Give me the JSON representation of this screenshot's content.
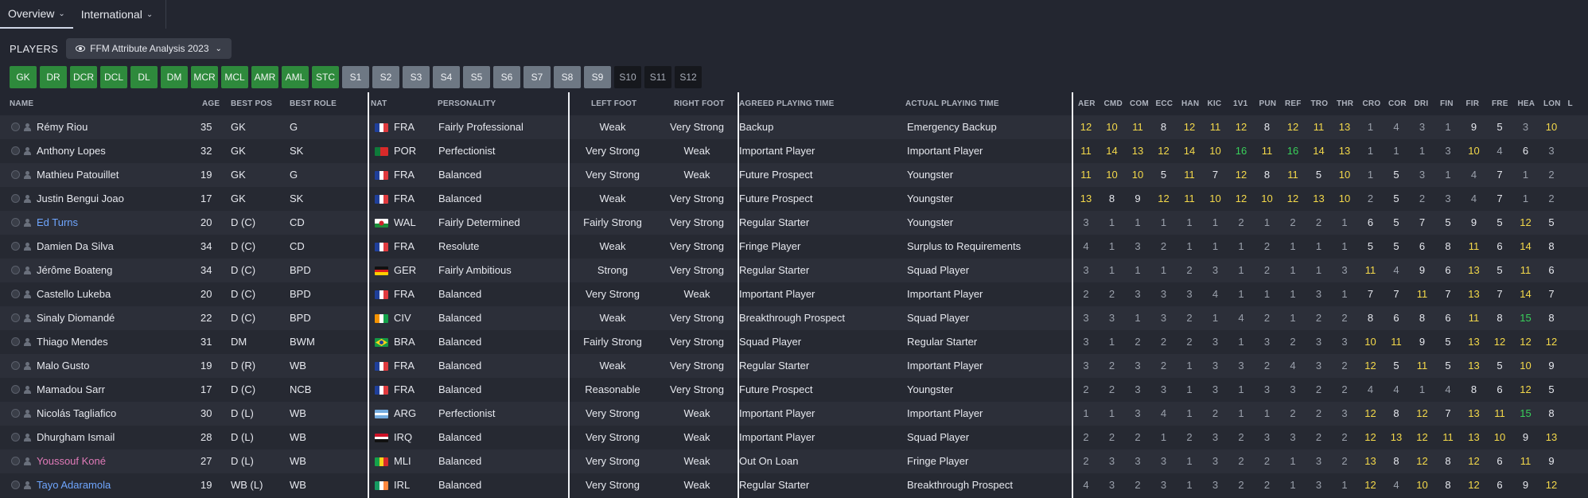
{
  "top_tabs": [
    {
      "label": "Overview",
      "active": true
    },
    {
      "label": "International",
      "active": false
    }
  ],
  "players_label": "PLAYERS",
  "view_selector": "FFM Attribute Analysis 2023",
  "position_filters": [
    {
      "label": "GK",
      "style": "green"
    },
    {
      "label": "DR",
      "style": "green"
    },
    {
      "label": "DCR",
      "style": "green"
    },
    {
      "label": "DCL",
      "style": "green"
    },
    {
      "label": "DL",
      "style": "green"
    },
    {
      "label": "DM",
      "style": "green"
    },
    {
      "label": "MCR",
      "style": "green"
    },
    {
      "label": "MCL",
      "style": "green"
    },
    {
      "label": "AMR",
      "style": "green"
    },
    {
      "label": "AML",
      "style": "green"
    },
    {
      "label": "STC",
      "style": "green"
    },
    {
      "label": "S1",
      "style": "grey"
    },
    {
      "label": "S2",
      "style": "grey"
    },
    {
      "label": "S3",
      "style": "grey"
    },
    {
      "label": "S4",
      "style": "grey"
    },
    {
      "label": "S5",
      "style": "grey"
    },
    {
      "label": "S6",
      "style": "grey"
    },
    {
      "label": "S7",
      "style": "grey"
    },
    {
      "label": "S8",
      "style": "grey"
    },
    {
      "label": "S9",
      "style": "grey"
    },
    {
      "label": "S10",
      "style": "dark"
    },
    {
      "label": "S11",
      "style": "dark"
    },
    {
      "label": "S12",
      "style": "dark"
    }
  ],
  "headers": {
    "name": "NAME",
    "age": "AGE",
    "best_pos": "BEST POS",
    "best_role": "BEST ROLE",
    "nat": "NAT",
    "personality": "PERSONALITY",
    "left_foot": "LEFT FOOT",
    "right_foot": "RIGHT FOOT",
    "agreed": "AGREED PLAYING TIME",
    "actual": "ACTUAL PLAYING TIME"
  },
  "attr_headers": [
    "AER",
    "CMD",
    "COM",
    "ECC",
    "HAN",
    "KIC",
    "1V1",
    "PUN",
    "REF",
    "TRO",
    "THR",
    "CRO",
    "COR",
    "DRI",
    "FIN",
    "FIR",
    "FRE",
    "HEA",
    "LON",
    "L"
  ],
  "attr_colors": {
    "low": "#9aa0ab",
    "mid": "#e6e8ee",
    "high": "#f4d94a",
    "top": "#39d05a"
  },
  "players": [
    {
      "name": "Rémy Riou",
      "color": "default",
      "age": "35",
      "pos": "GK",
      "role": "G",
      "flag": "fra",
      "nat": "FRA",
      "personality": "Fairly Professional",
      "lf": "Weak",
      "rf": "Very Strong",
      "agreed": "Backup",
      "actual": "Emergency Backup",
      "attrs": [
        12,
        10,
        11,
        8,
        12,
        11,
        12,
        8,
        12,
        11,
        13,
        1,
        4,
        3,
        1,
        9,
        5,
        3,
        10
      ]
    },
    {
      "name": "Anthony Lopes",
      "color": "default",
      "age": "32",
      "pos": "GK",
      "role": "SK",
      "flag": "por",
      "nat": "POR",
      "personality": "Perfectionist",
      "lf": "Very Strong",
      "rf": "Weak",
      "agreed": "Important Player",
      "actual": "Important Player",
      "attrs": [
        11,
        14,
        13,
        12,
        14,
        10,
        16,
        11,
        16,
        14,
        13,
        1,
        1,
        1,
        3,
        10,
        4,
        6,
        3
      ]
    },
    {
      "name": "Mathieu Patouillet",
      "color": "default",
      "age": "19",
      "pos": "GK",
      "role": "G",
      "flag": "fra",
      "nat": "FRA",
      "personality": "Balanced",
      "lf": "Very Strong",
      "rf": "Weak",
      "agreed": "Future Prospect",
      "actual": "Youngster",
      "attrs": [
        11,
        10,
        10,
        5,
        11,
        7,
        12,
        8,
        11,
        5,
        10,
        1,
        5,
        3,
        1,
        4,
        7,
        1,
        2
      ]
    },
    {
      "name": "Justin Bengui Joao",
      "color": "default",
      "age": "17",
      "pos": "GK",
      "role": "SK",
      "flag": "fra",
      "nat": "FRA",
      "personality": "Balanced",
      "lf": "Weak",
      "rf": "Very Strong",
      "agreed": "Future Prospect",
      "actual": "Youngster",
      "attrs": [
        13,
        8,
        9,
        12,
        11,
        10,
        12,
        10,
        12,
        13,
        10,
        2,
        5,
        2,
        3,
        4,
        7,
        1,
        2
      ]
    },
    {
      "name": "Ed Turns",
      "color": "blue",
      "age": "20",
      "pos": "D (C)",
      "role": "CD",
      "flag": "wal",
      "nat": "WAL",
      "personality": "Fairly Determined",
      "lf": "Fairly Strong",
      "rf": "Very Strong",
      "agreed": "Regular Starter",
      "actual": "Youngster",
      "attrs": [
        3,
        1,
        1,
        1,
        1,
        1,
        2,
        1,
        2,
        2,
        1,
        6,
        5,
        7,
        5,
        9,
        5,
        12,
        5
      ]
    },
    {
      "name": "Damien Da Silva",
      "color": "default",
      "age": "34",
      "pos": "D (C)",
      "role": "CD",
      "flag": "fra",
      "nat": "FRA",
      "personality": "Resolute",
      "lf": "Weak",
      "rf": "Very Strong",
      "agreed": "Fringe Player",
      "actual": "Surplus to Requirements",
      "attrs": [
        4,
        1,
        3,
        2,
        1,
        1,
        1,
        2,
        1,
        1,
        1,
        5,
        5,
        6,
        8,
        11,
        6,
        14,
        8
      ]
    },
    {
      "name": "Jérôme Boateng",
      "color": "default",
      "age": "34",
      "pos": "D (C)",
      "role": "BPD",
      "flag": "ger",
      "nat": "GER",
      "personality": "Fairly Ambitious",
      "lf": "Strong",
      "rf": "Very Strong",
      "agreed": "Regular Starter",
      "actual": "Squad Player",
      "attrs": [
        3,
        1,
        1,
        1,
        2,
        3,
        1,
        2,
        1,
        1,
        3,
        11,
        4,
        9,
        6,
        13,
        5,
        11,
        6
      ]
    },
    {
      "name": "Castello Lukeba",
      "color": "default",
      "age": "20",
      "pos": "D (C)",
      "role": "BPD",
      "flag": "fra",
      "nat": "FRA",
      "personality": "Balanced",
      "lf": "Very Strong",
      "rf": "Weak",
      "agreed": "Important Player",
      "actual": "Important Player",
      "attrs": [
        2,
        2,
        3,
        3,
        3,
        4,
        1,
        1,
        1,
        3,
        1,
        7,
        7,
        11,
        7,
        13,
        7,
        14,
        7
      ]
    },
    {
      "name": "Sinaly Diomandé",
      "color": "default",
      "age": "22",
      "pos": "D (C)",
      "role": "BPD",
      "flag": "civ",
      "nat": "CIV",
      "personality": "Balanced",
      "lf": "Weak",
      "rf": "Very Strong",
      "agreed": "Breakthrough Prospect",
      "actual": "Squad Player",
      "attrs": [
        3,
        3,
        1,
        3,
        2,
        1,
        4,
        2,
        1,
        2,
        2,
        8,
        6,
        8,
        6,
        11,
        8,
        15,
        8
      ]
    },
    {
      "name": "Thiago Mendes",
      "color": "default",
      "age": "31",
      "pos": "DM",
      "role": "BWM",
      "flag": "bra",
      "nat": "BRA",
      "personality": "Balanced",
      "lf": "Fairly Strong",
      "rf": "Very Strong",
      "agreed": "Squad Player",
      "actual": "Regular Starter",
      "attrs": [
        3,
        1,
        2,
        2,
        2,
        3,
        1,
        3,
        2,
        3,
        3,
        10,
        11,
        9,
        5,
        13,
        12,
        12,
        12
      ]
    },
    {
      "name": "Malo Gusto",
      "color": "default",
      "age": "19",
      "pos": "D (R)",
      "role": "WB",
      "flag": "fra",
      "nat": "FRA",
      "personality": "Balanced",
      "lf": "Weak",
      "rf": "Very Strong",
      "agreed": "Regular Starter",
      "actual": "Important Player",
      "attrs": [
        3,
        2,
        3,
        2,
        1,
        3,
        3,
        2,
        4,
        3,
        2,
        12,
        5,
        11,
        5,
        13,
        5,
        10,
        9
      ]
    },
    {
      "name": "Mamadou Sarr",
      "color": "default",
      "age": "17",
      "pos": "D (C)",
      "role": "NCB",
      "flag": "fra",
      "nat": "FRA",
      "personality": "Balanced",
      "lf": "Reasonable",
      "rf": "Very Strong",
      "agreed": "Future Prospect",
      "actual": "Youngster",
      "attrs": [
        2,
        2,
        3,
        3,
        1,
        3,
        1,
        3,
        3,
        2,
        2,
        4,
        4,
        1,
        4,
        8,
        6,
        12,
        5
      ]
    },
    {
      "name": "Nicolás Tagliafico",
      "color": "default",
      "age": "30",
      "pos": "D (L)",
      "role": "WB",
      "flag": "arg",
      "nat": "ARG",
      "personality": "Perfectionist",
      "lf": "Very Strong",
      "rf": "Weak",
      "agreed": "Important Player",
      "actual": "Important Player",
      "attrs": [
        1,
        1,
        3,
        4,
        1,
        2,
        1,
        1,
        2,
        2,
        3,
        12,
        8,
        12,
        7,
        13,
        11,
        15,
        8
      ]
    },
    {
      "name": "Dhurgham Ismail",
      "color": "default",
      "age": "28",
      "pos": "D (L)",
      "role": "WB",
      "flag": "irq",
      "nat": "IRQ",
      "personality": "Balanced",
      "lf": "Very Strong",
      "rf": "Weak",
      "agreed": "Important Player",
      "actual": "Squad Player",
      "attrs": [
        2,
        2,
        2,
        1,
        2,
        3,
        2,
        3,
        3,
        2,
        2,
        12,
        13,
        12,
        11,
        13,
        10,
        9,
        13
      ]
    },
    {
      "name": "Youssouf Koné",
      "color": "pink",
      "age": "27",
      "pos": "D (L)",
      "role": "WB",
      "flag": "mli",
      "nat": "MLI",
      "personality": "Balanced",
      "lf": "Very Strong",
      "rf": "Weak",
      "agreed": "Out On Loan",
      "actual": "Fringe Player",
      "attrs": [
        2,
        3,
        3,
        3,
        1,
        3,
        2,
        2,
        1,
        3,
        2,
        13,
        8,
        12,
        8,
        12,
        6,
        11,
        9
      ]
    },
    {
      "name": "Tayo Adaramola",
      "color": "blue",
      "age": "19",
      "pos": "WB (L)",
      "role": "WB",
      "flag": "irl",
      "nat": "IRL",
      "personality": "Balanced",
      "lf": "Very Strong",
      "rf": "Weak",
      "agreed": "Regular Starter",
      "actual": "Breakthrough Prospect",
      "attrs": [
        4,
        3,
        2,
        3,
        1,
        3,
        2,
        2,
        1,
        3,
        1,
        12,
        4,
        10,
        8,
        12,
        6,
        9,
        12
      ]
    }
  ]
}
